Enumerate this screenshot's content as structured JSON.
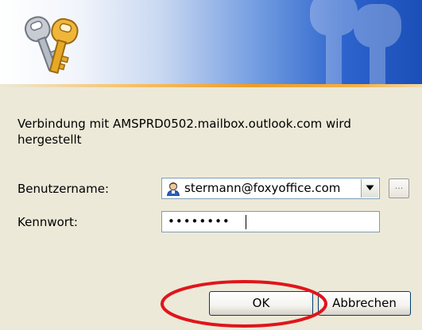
{
  "dialog": {
    "message": "Verbindung mit AMSPRD0502.mailbox.outlook.com wird hergestellt",
    "username_label": "Benutzername:",
    "username_value": "stermann@foxyoffice.com",
    "browse_label": "...",
    "password_label": "Kennwort:",
    "password_masked": "••••••••",
    "ok_label": "OK",
    "cancel_label": "Abbrechen"
  },
  "icons": {
    "banner": "keys-icon",
    "watermark": "keys-watermark-icon",
    "user": "user-icon",
    "dropdown": "chevron-down-icon"
  },
  "colors": {
    "banner_blue": "#1b4fb8",
    "accent_orange": "#f29b22",
    "highlight_red": "#e0151b",
    "dialog_background": "#ece9d8"
  }
}
